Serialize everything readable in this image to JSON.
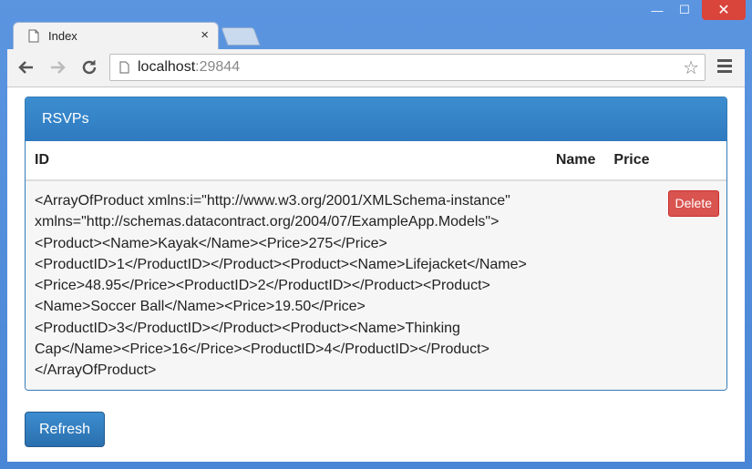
{
  "browser": {
    "tab_title": "Index",
    "tab_close": "×",
    "url_host": "localhost",
    "url_port": ":29844",
    "window_controls": {
      "minimize": "—",
      "maximize": "☐",
      "close": "✕"
    }
  },
  "panel": {
    "heading": "RSVPs",
    "columns": [
      "ID",
      "Name",
      "Price"
    ],
    "row": {
      "id_text": "<ArrayOfProduct xmlns:i=\"http://www.w3.org/2001/XMLSchema-instance\" xmlns=\"http://schemas.datacontract.org/2004/07/ExampleApp.Models\"><Product><Name>Kayak</Name><Price>275</Price><ProductID>1</ProductID></Product><Product><Name>Lifejacket</Name><Price>48.95</Price><ProductID>2</ProductID></Product><Product><Name>Soccer Ball</Name><Price>19.50</Price><ProductID>3</ProductID></Product><Product><Name>Thinking Cap</Name><Price>16</Price><ProductID>4</ProductID></Product></ArrayOfProduct>",
      "name": "",
      "price": "",
      "delete_label": "Delete"
    }
  },
  "refresh_label": "Refresh",
  "colors": {
    "primary": "#337ab7",
    "danger": "#d9534f",
    "window_frame": "#5b95e0"
  }
}
